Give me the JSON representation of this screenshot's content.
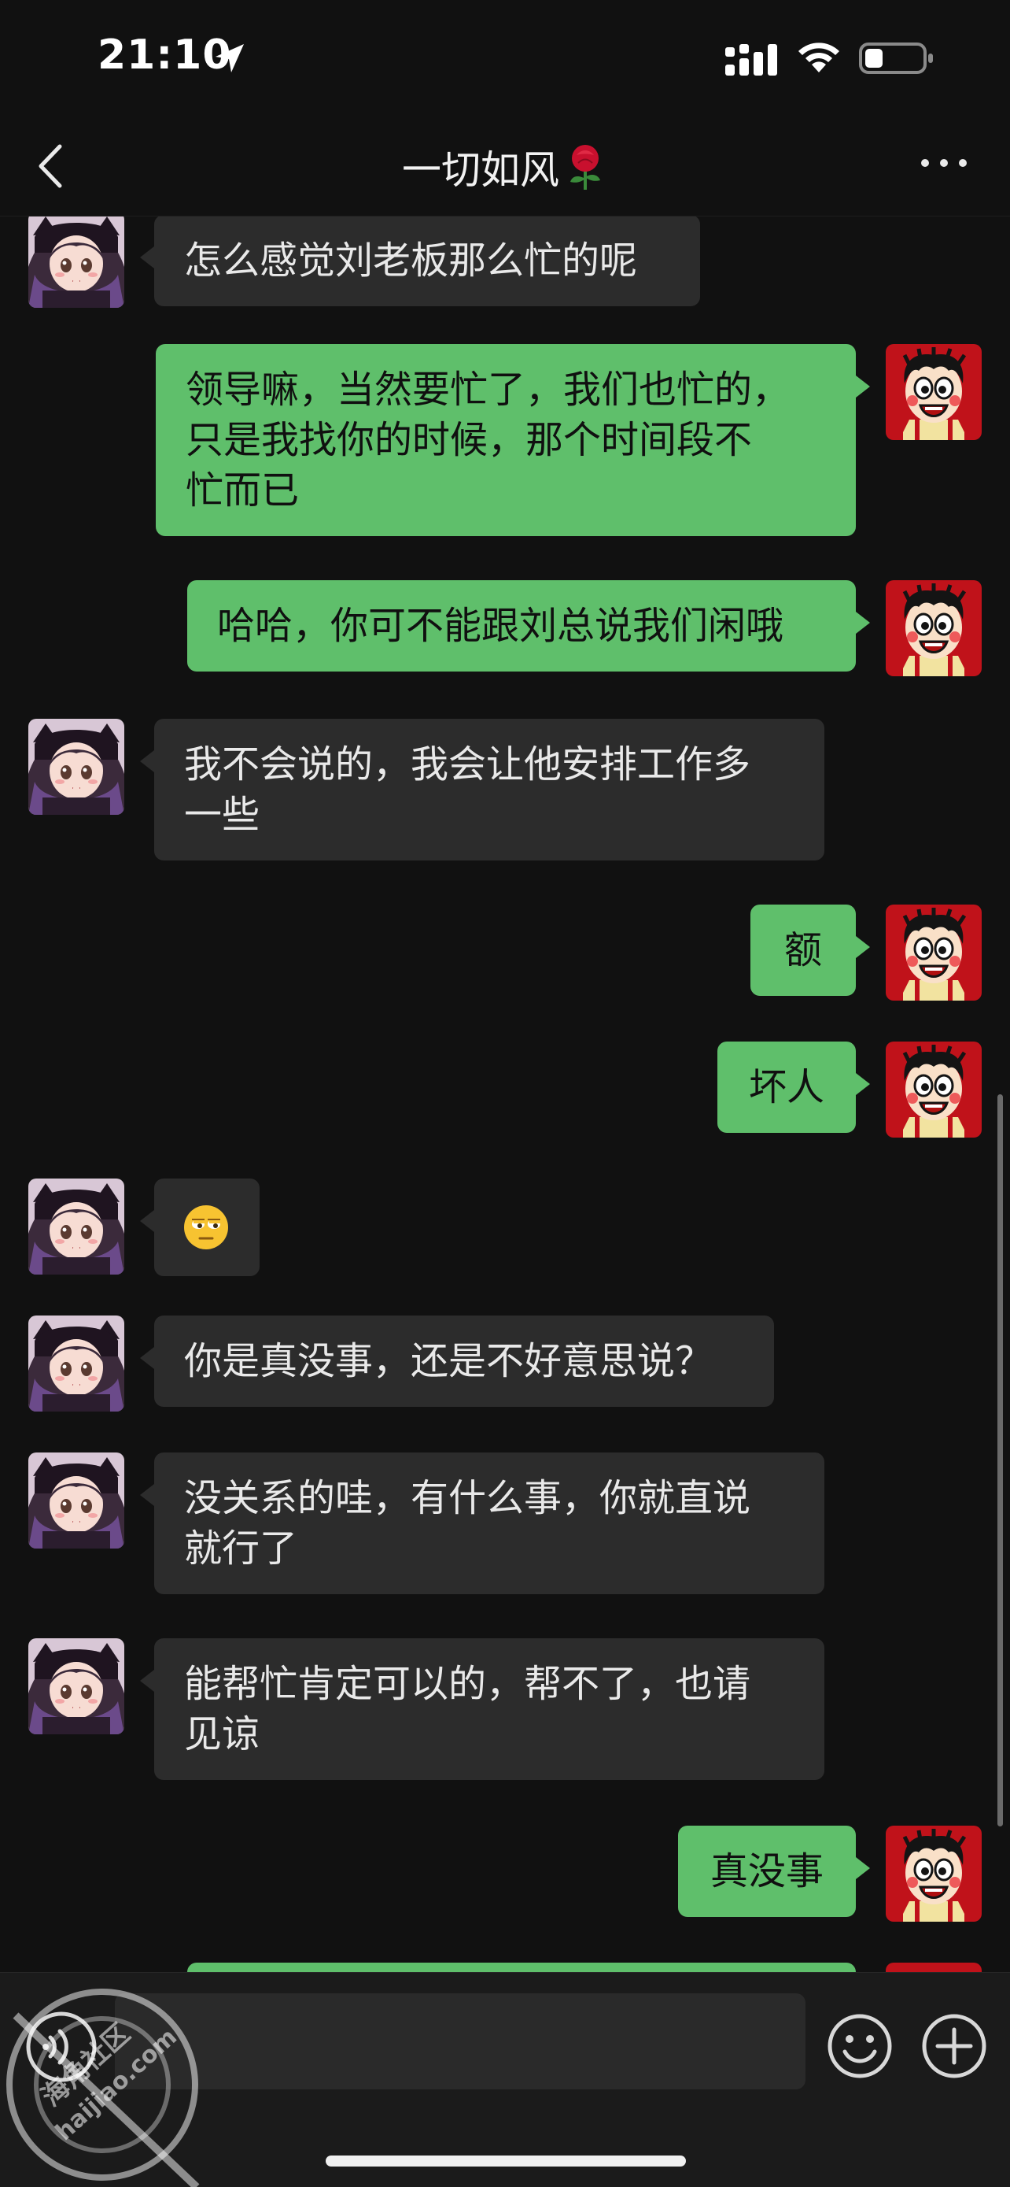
{
  "status_bar": {
    "time": "21:10",
    "location_icon": "location-arrow-icon",
    "signal_icon": "cellular-signal-icon",
    "wifi_icon": "wifi-icon",
    "battery_icon": "battery-icon"
  },
  "nav": {
    "title": "一切如风",
    "title_emoji": "rose-icon",
    "back_icon": "chevron-left-icon",
    "more_icon": "more-dots-icon"
  },
  "messages": [
    {
      "side": "in",
      "text_lines": [
        "怎么感觉刘老板那么忙的呢"
      ]
    },
    {
      "side": "out",
      "text_lines": [
        "领导嘛，当然要忙了，我们也忙的，",
        "只是我找你的时候，那个时间段不",
        "忙而已"
      ]
    },
    {
      "side": "out",
      "text_lines": [
        "哈哈，你可不能跟刘总说我们闲哦"
      ]
    },
    {
      "side": "in",
      "text_lines": [
        "我不会说的，我会让他安排工作多",
        "一些"
      ]
    },
    {
      "side": "out",
      "text_lines": [
        "额"
      ]
    },
    {
      "side": "out",
      "text_lines": [
        "坏人"
      ]
    },
    {
      "side": "in",
      "emoji": "eye-roll-emoji-icon"
    },
    {
      "side": "in",
      "text_lines": [
        "你是真没事，还是不好意思说？"
      ]
    },
    {
      "side": "in",
      "text_lines": [
        "没关系的哇，有什么事，你就直说",
        "就行了"
      ]
    },
    {
      "side": "in",
      "text_lines": [
        "能帮忙肯定可以的，帮不了，也请",
        "见谅"
      ]
    },
    {
      "side": "out",
      "text_lines": [
        "真没事"
      ]
    }
  ],
  "input_bar": {
    "voice_icon": "voice-icon",
    "text_value": "",
    "emoji_icon": "emoji-icon",
    "plus_icon": "plus-circle-icon"
  },
  "watermark": {
    "line1": "海角社区",
    "line2": "haijiao.com"
  },
  "colors": {
    "background": "#111111",
    "incoming_bubble": "#2c2c2c",
    "outgoing_bubble": "#5fbf6b",
    "input_field": "#2a2a2a"
  }
}
